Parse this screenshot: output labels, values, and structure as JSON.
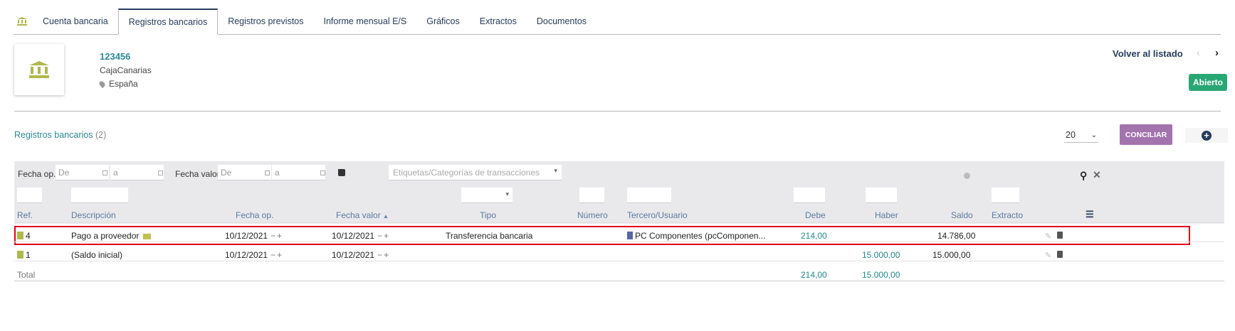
{
  "tabs": [
    "Cuenta bancaria",
    "Registros bancarios",
    "Registros previstos",
    "Informe mensual E/S",
    "Gráficos",
    "Extractos",
    "Documentos"
  ],
  "account": {
    "number": "123456",
    "bank": "CajaCanarias",
    "country": "España"
  },
  "nav": {
    "back": "Volver al listado",
    "status": "Abierto"
  },
  "section": {
    "title": "Registros bancarios",
    "count": "(2)",
    "page_size": "20",
    "conciliar": "CONCILIAR"
  },
  "filters": {
    "fecha_op": "Fecha op.",
    "fecha_valor": "Fecha valor",
    "de_placeholder": "De",
    "a_placeholder": "a",
    "tags_placeholder": "Etiquetas/Categorías de transacciones"
  },
  "columns": {
    "ref": "Ref.",
    "descripcion": "Descripción",
    "fecha_op": "Fecha op.",
    "fecha_valor": "Fecha valor",
    "tipo": "Tipo",
    "numero": "Número",
    "tercero": "Tercero/Usuario",
    "debe": "Debe",
    "haber": "Haber",
    "saldo": "Saldo",
    "extracto": "Extracto"
  },
  "rows": [
    {
      "ref": "4",
      "descripcion": "Pago a proveedor",
      "fecha_op": "10/12/2021",
      "fecha_valor": "10/12/2021",
      "tipo": "Transferencia bancaria",
      "tercero": "PC Componentes (pcComponen...",
      "debe": "214,00",
      "haber": "",
      "saldo": "14.786,00"
    },
    {
      "ref": "1",
      "descripcion": "(Saldo inicial)",
      "fecha_op": "10/12/2021",
      "fecha_valor": "10/12/2021",
      "tipo": "",
      "tercero": "",
      "debe": "",
      "haber": "15.000,00",
      "saldo": "15.000,00"
    }
  ],
  "totals": {
    "label": "Total",
    "debe": "214,00",
    "haber": "15.000,00"
  },
  "colors": {
    "accent": "#263c5c",
    "teal": "#2a8a93",
    "status_green": "#28a775",
    "conciliar": "#a373ad",
    "highlight": "#e3001b"
  }
}
